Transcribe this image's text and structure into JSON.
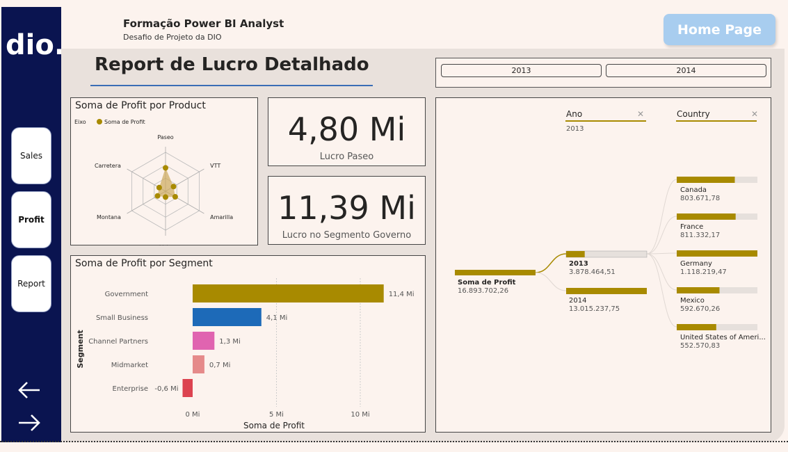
{
  "sidebar": {
    "logo_text": "dio.",
    "nav": [
      {
        "label": "Sales",
        "active": false
      },
      {
        "label": "Profit",
        "active": true
      },
      {
        "label": "Report",
        "active": false
      }
    ],
    "back_icon": "arrow-left-icon",
    "forward_icon": "arrow-right-icon"
  },
  "header": {
    "title": "Formação Power BI Analyst",
    "subtitle": "Desafio de Projeto da DIO",
    "home_button": "Home Page"
  },
  "report_title": "Report de Lucro Detalhado",
  "slicer": {
    "options": [
      "2013",
      "2014"
    ]
  },
  "kpis": [
    {
      "value": "4,80 Mi",
      "label": "Lucro Paseo"
    },
    {
      "value": "11,39 Mi",
      "label": "Lucro no Segmento Governo"
    }
  ],
  "radar": {
    "title": "Soma de Profit por Product",
    "legend_axis": "Eixo",
    "legend_series": "Soma de Profit",
    "color": "#a88a00",
    "chart_data": {
      "type": "radar",
      "categories": [
        "Paseo",
        "VTT",
        "Amarilla",
        "Velo",
        "Montana",
        "Carretera"
      ],
      "values": [
        4.8,
        1.9,
        2.3,
        1.2,
        1.9,
        1.5
      ],
      "max": 8
    }
  },
  "bars": {
    "title": "Soma de Profit por Segment",
    "ylabel": "Segment",
    "xlabel": "Soma de Profit",
    "chart_data": {
      "type": "bar",
      "orientation": "horizontal",
      "categories": [
        "Government",
        "Small Business",
        "Channel Partners",
        "Midmarket",
        "Enterprise"
      ],
      "values": [
        11.4,
        4.1,
        1.3,
        0.7,
        -0.6
      ],
      "value_labels": [
        "11,4 Mi",
        "4,1 Mi",
        "1,3 Mi",
        "0,7 Mi",
        "-0,6 Mi"
      ],
      "colors": [
        "#a88a00",
        "#1d6ab8",
        "#e064b0",
        "#e58a8a",
        "#dc4350"
      ],
      "xticks": [
        "0 Mi",
        "5 Mi",
        "10 Mi"
      ],
      "xtick_values": [
        0,
        5,
        10
      ],
      "xlim": [
        -0.6,
        12.6
      ]
    }
  },
  "tree": {
    "root": {
      "label": "Soma de Profit",
      "value": "16.893.702,26"
    },
    "levels": [
      {
        "label": "Ano",
        "filter": "2013",
        "close_icon": "close-icon"
      },
      {
        "label": "Country",
        "close_icon": "close-icon"
      }
    ],
    "years": [
      {
        "label": "2013",
        "value": "3.878.464,51",
        "fraction": 0.23,
        "selected": true
      },
      {
        "label": "2014",
        "value": "13.015.237,75",
        "fraction": 1.0,
        "selected": false
      }
    ],
    "countries": [
      {
        "label": "Canada",
        "value": "803.671,78",
        "fraction": 0.72
      },
      {
        "label": "France",
        "value": "811.332,17",
        "fraction": 0.73
      },
      {
        "label": "Germany",
        "value": "1.118.219,47",
        "fraction": 1.0
      },
      {
        "label": "Mexico",
        "value": "592.670,26",
        "fraction": 0.53
      },
      {
        "label": "United States of Ameri...",
        "value": "552.570,83",
        "fraction": 0.49
      }
    ],
    "bar_color": "#a88a00",
    "bar_bg": "#e6e0dc"
  }
}
